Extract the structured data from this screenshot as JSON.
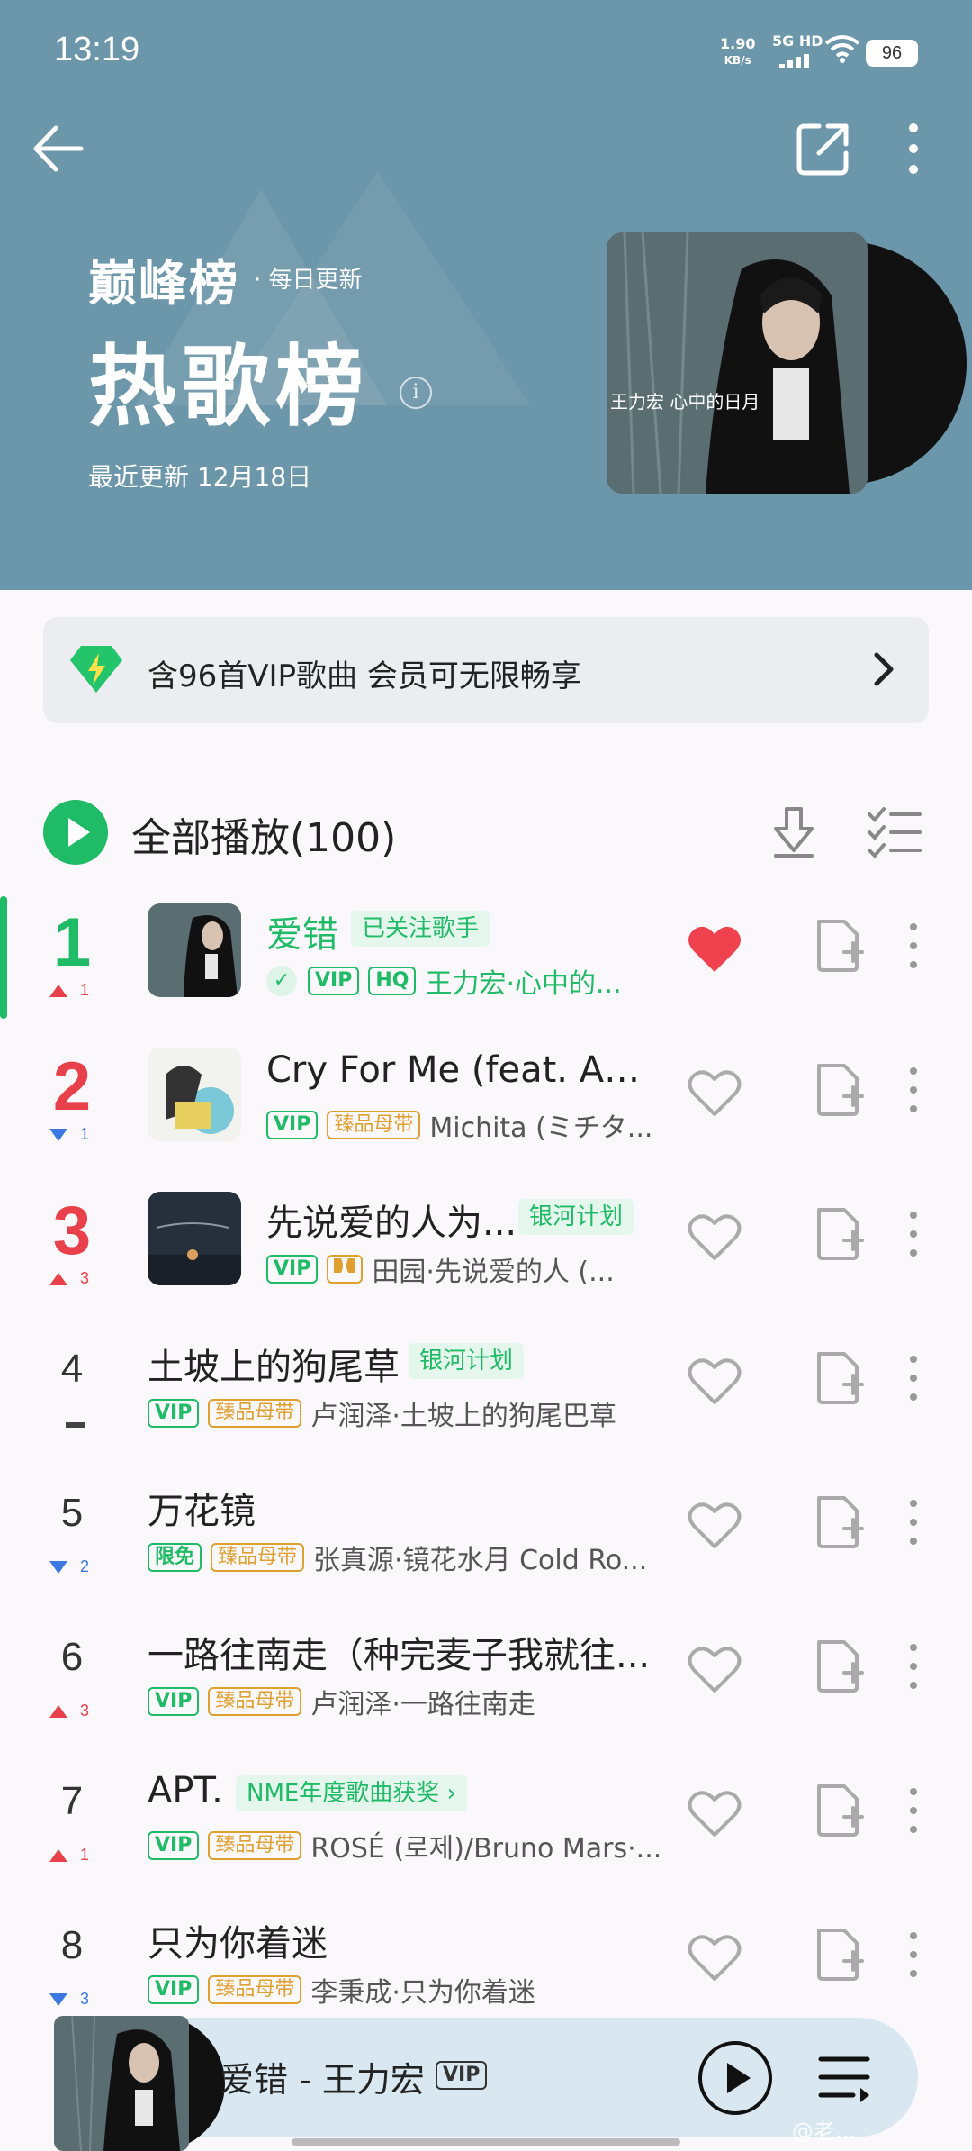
{
  "status": {
    "time": "13:19",
    "speed_value": "1.90",
    "speed_unit": "KB/s",
    "network": "5G HD",
    "battery": "96"
  },
  "header": {
    "brand": "巅峰榜",
    "brand_sub": "· 每日更新",
    "title": "热歌榜",
    "info_glyph": "i",
    "updated": "最近更新 12月18日",
    "cover_text": "王力宏 心中的日月"
  },
  "vip_banner": {
    "text": "含96首VIP歌曲 会员可无限畅享"
  },
  "play_all": {
    "label": "全部播放(100)"
  },
  "songs": [
    {
      "rank": "1",
      "trend": "up",
      "change": "1",
      "title": "爱错",
      "tag": "已关注歌手",
      "verified": true,
      "chips": [
        "VIP",
        "HQ"
      ],
      "artist": "王力宏·心中的...",
      "liked": true
    },
    {
      "rank": "2",
      "trend": "down",
      "change": "1",
      "title": "Cry For Me (feat. Ami...",
      "tag": "",
      "chips": [
        "VIP",
        "臻品母带"
      ],
      "artist": "Michita (ミチタ...",
      "liked": false
    },
    {
      "rank": "3",
      "trend": "up",
      "change": "3",
      "title": "先说爱的人为...",
      "tag": "银河计划",
      "chips": [
        "VIP",
        "DOLBY"
      ],
      "artist": "田园·先说爱的人 (...",
      "liked": false
    },
    {
      "rank": "4",
      "trend": "flat",
      "change": "",
      "title": "土坡上的狗尾草",
      "tag": "银河计划",
      "chips": [
        "VIP",
        "臻品母带"
      ],
      "artist": "卢润泽·土坡上的狗尾巴草",
      "liked": false
    },
    {
      "rank": "5",
      "trend": "down",
      "change": "2",
      "title": "万花镜",
      "tag": "",
      "chips": [
        "限免",
        "臻品母带"
      ],
      "artist": "张真源·镜花水月 Cold Ro...",
      "liked": false
    },
    {
      "rank": "6",
      "trend": "up",
      "change": "3",
      "title": "一路往南走（种完麦子我就往...",
      "tag": "",
      "chips": [
        "VIP",
        "臻品母带"
      ],
      "artist": "卢润泽·一路往南走",
      "liked": false
    },
    {
      "rank": "7",
      "trend": "up",
      "change": "1",
      "title": "APT.",
      "tag": "NME年度歌曲获奖 ›",
      "chips": [
        "VIP",
        "臻品母带"
      ],
      "artist": "ROSÉ (로제)/Bruno Mars·...",
      "liked": false
    },
    {
      "rank": "8",
      "trend": "down",
      "change": "3",
      "title": "只为你着迷",
      "tag": "",
      "chips": [
        "VIP",
        "臻品母带"
      ],
      "artist": "李秉成·只为你着迷",
      "liked": false
    }
  ],
  "mini_player": {
    "title": "爱错 - 王力宏",
    "badge": "VIP"
  },
  "watermark": "@老...",
  "colors": {
    "accent": "#1fbb66",
    "header_bg": "#6c96a9",
    "rank_top": "#e8414b",
    "heart": "#f0424e",
    "gold": "#e0a030"
  }
}
